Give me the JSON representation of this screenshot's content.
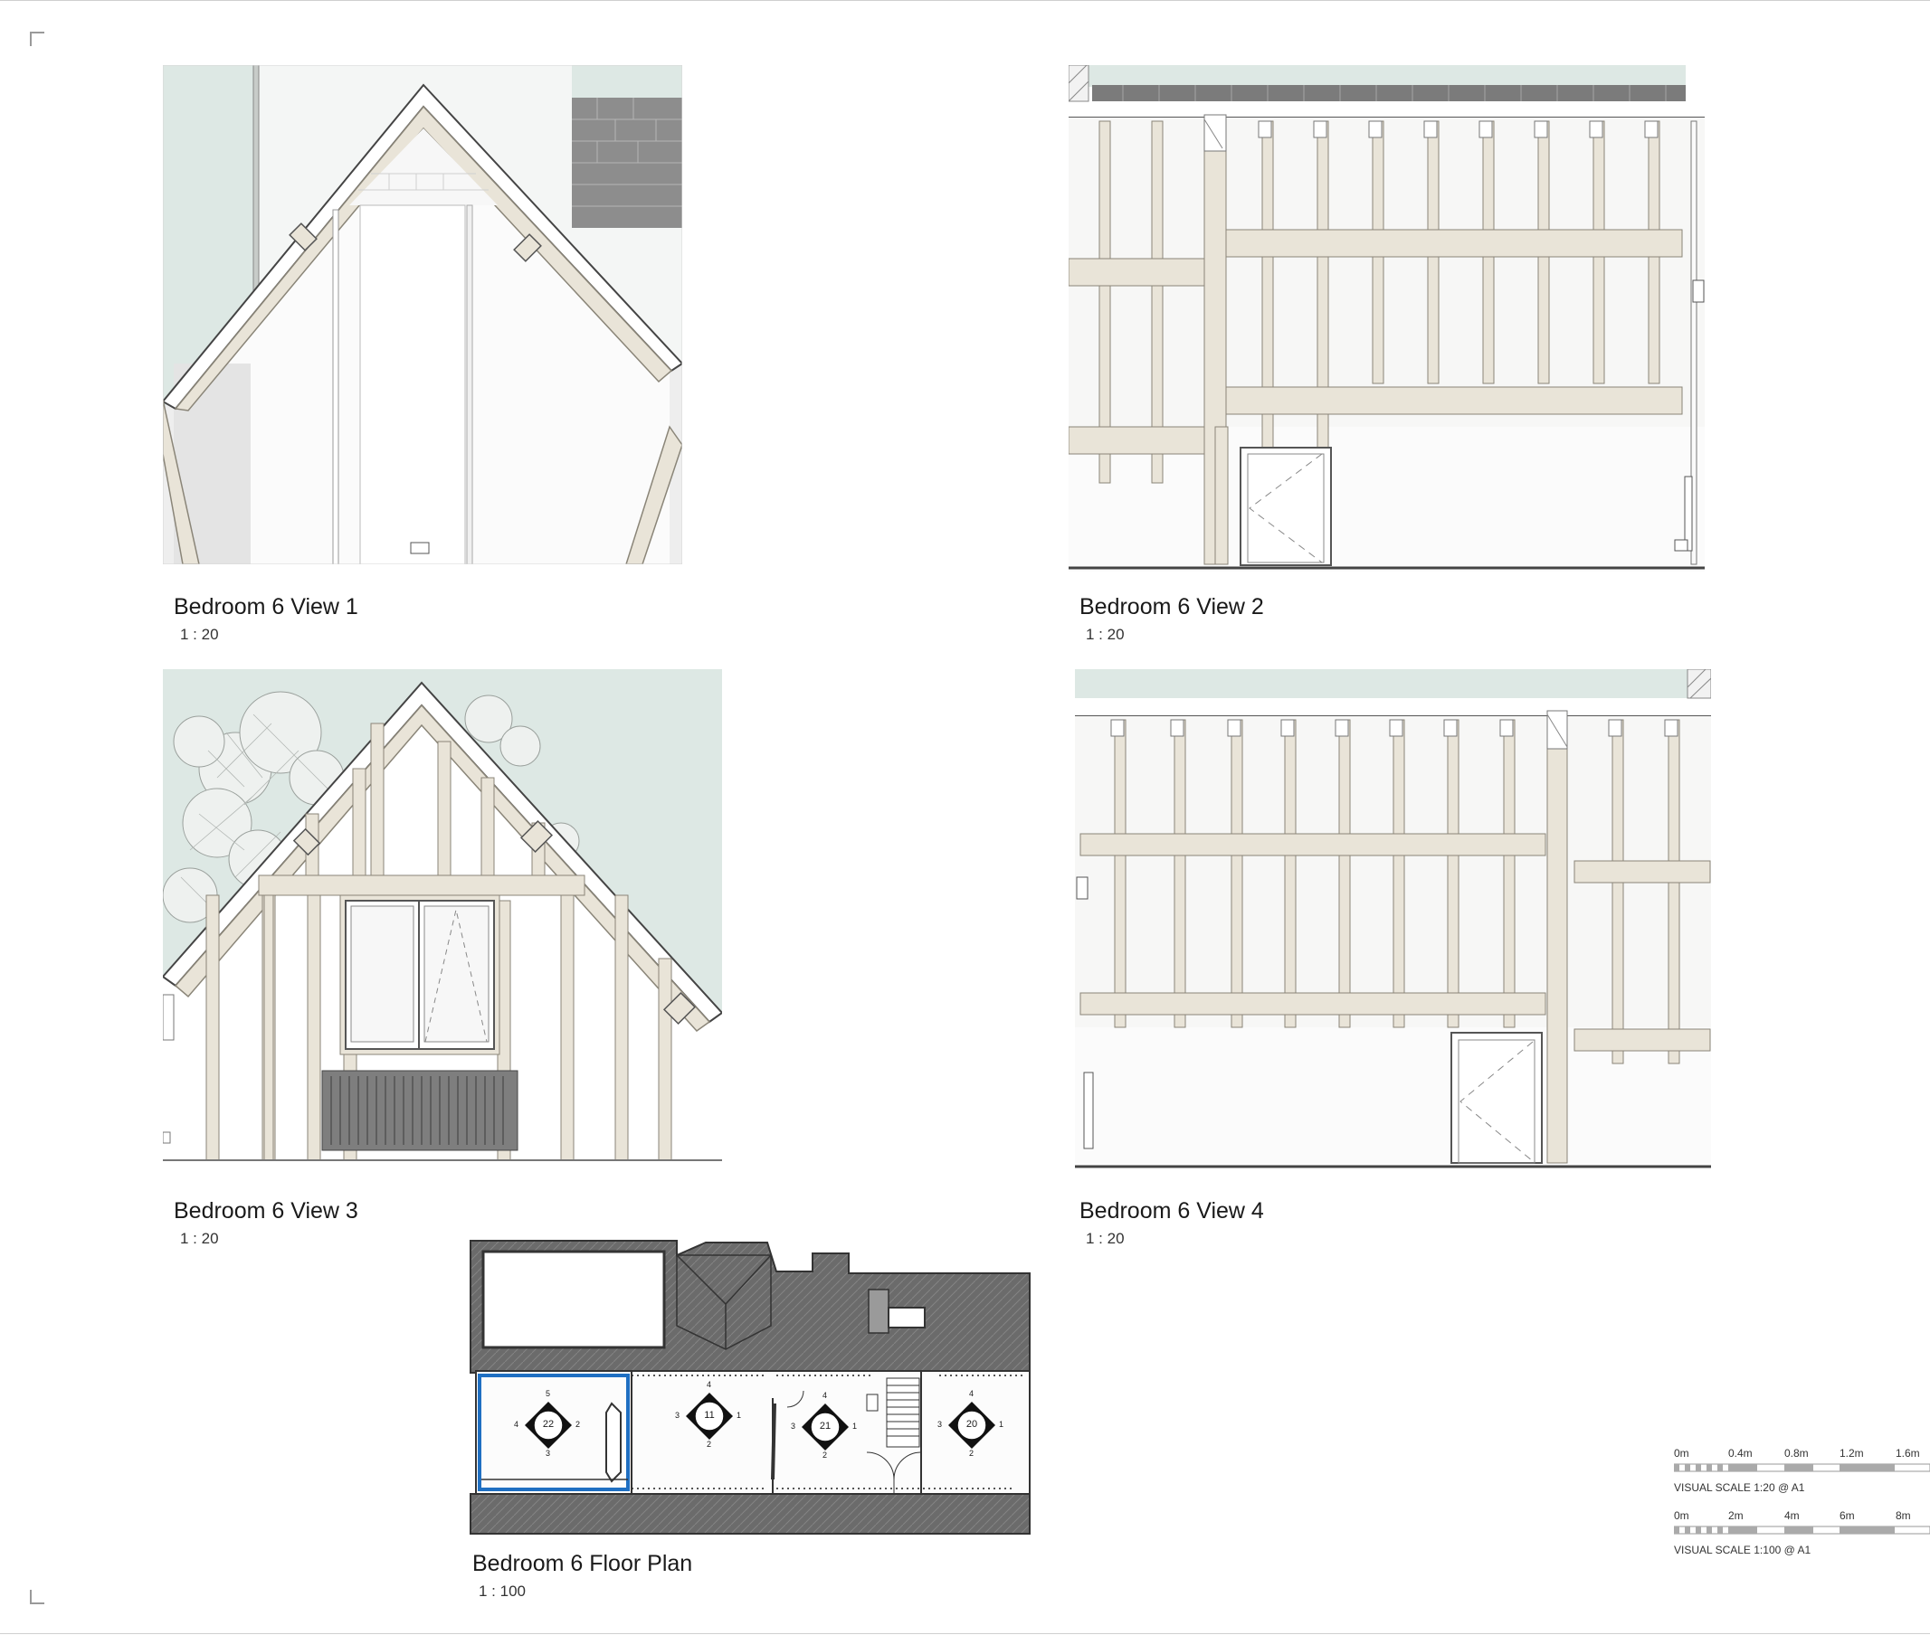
{
  "views": [
    {
      "id": "view1",
      "title": "Bedroom 6 View 1",
      "scale": "1 : 20"
    },
    {
      "id": "view2",
      "title": "Bedroom 6 View 2",
      "scale": "1 : 20"
    },
    {
      "id": "view3",
      "title": "Bedroom 6 View 3",
      "scale": "1 : 20"
    },
    {
      "id": "view4",
      "title": "Bedroom 6 View 4",
      "scale": "1 : 20"
    }
  ],
  "floor_plan": {
    "title": "Bedroom 6 Floor Plan",
    "scale": "1 : 100",
    "markers": [
      {
        "number": "22",
        "top": "5",
        "left": "4",
        "right": "2",
        "bottom": "3"
      },
      {
        "number": "11",
        "top": "4",
        "left": "3",
        "right": "1",
        "bottom": "2"
      },
      {
        "number": "21",
        "top": "4",
        "left": "3",
        "right": "1",
        "bottom": "2"
      },
      {
        "number": "20",
        "top": "4",
        "left": "3",
        "right": "1",
        "bottom": "2"
      }
    ]
  },
  "visual_scales": [
    {
      "ticks": [
        "0m",
        "0.4m",
        "0.8m",
        "1.2m",
        "1.6m"
      ],
      "caption": "VISUAL SCALE 1:20  @ A1"
    },
    {
      "ticks": [
        "0m",
        "2m",
        "4m",
        "6m",
        "8m"
      ],
      "caption": "VISUAL SCALE 1:100  @ A1"
    }
  ],
  "colors": {
    "timber": "#e9e4d8",
    "timber_edge": "#8a8578",
    "sky": "#dde8e4",
    "wall": "#fbfbfb",
    "roof_tile": "#6b6b6b",
    "highlight": "#1f6fc2"
  }
}
